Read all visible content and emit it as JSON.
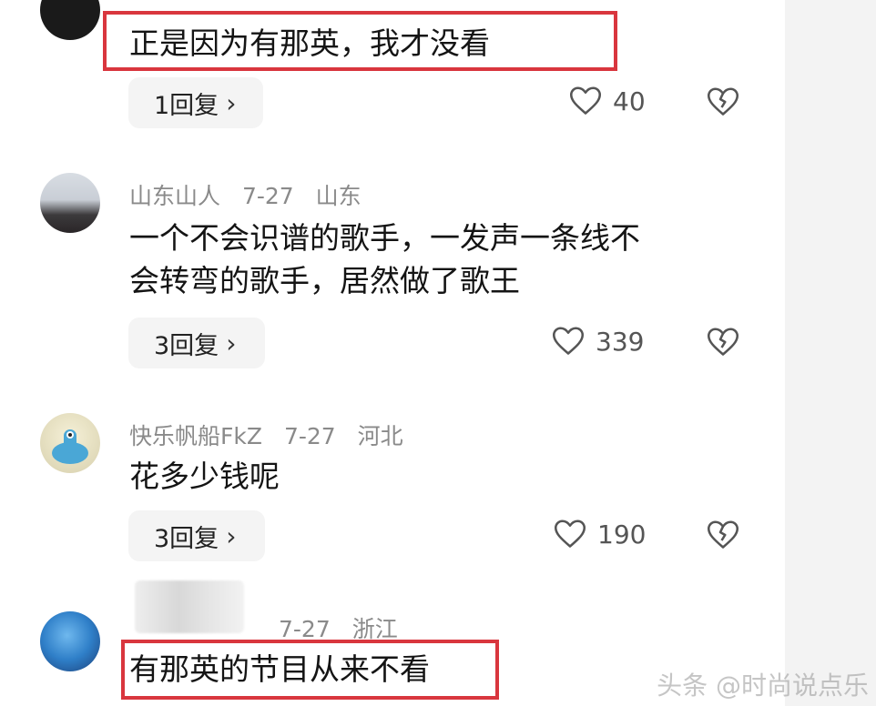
{
  "colors": {
    "highlight": "#d9363e",
    "meta": "#8a8a8a",
    "reply_bg": "#f4f4f4"
  },
  "comments": [
    {
      "text": "正是因为有那英，我才没看",
      "reply_label": "1回复",
      "likes": "40"
    },
    {
      "username": "山东山人",
      "date": "7-27",
      "location": "山东",
      "text_line1": "一个不会识谱的歌手，一发声一条线不",
      "text_line2": "会转弯的歌手，居然做了歌王",
      "reply_label": "3回复",
      "likes": "339"
    },
    {
      "username": "快乐帆船FkZ",
      "date": "7-27",
      "location": "河北",
      "text": "花多少钱呢",
      "reply_label": "3回复",
      "likes": "190"
    },
    {
      "date": "7-27",
      "location": "浙江",
      "text": "有那英的节目从来不看"
    }
  ],
  "watermark": "头条 @时尚说点乐",
  "icons": {
    "like": "heart-icon",
    "dislike": "broken-heart-icon",
    "chevron": "chevron-right-icon"
  }
}
